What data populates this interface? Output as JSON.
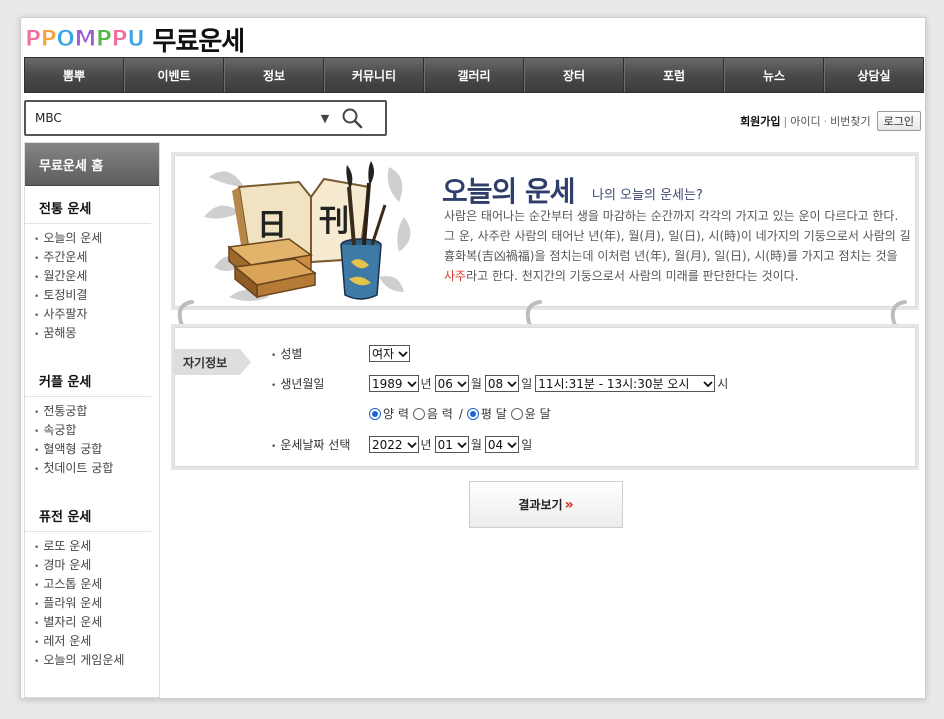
{
  "header": {
    "logo_letters": [
      "P",
      "P",
      "O",
      "M",
      "P",
      "P",
      "U"
    ],
    "logo_colors": [
      "#f36e9b",
      "#f9a23a",
      "#3aa4e8",
      "#9d5cd6",
      "#55b94a",
      "#f36e9b",
      "#3aa4e8"
    ],
    "site_title": "무료운세"
  },
  "nav": {
    "items": [
      "뽐뿌",
      "이벤트",
      "정보",
      "커뮤니티",
      "갤러리",
      "장터",
      "포럼",
      "뉴스",
      "상담실"
    ]
  },
  "search": {
    "value": "MBC",
    "dropdown_icon": "triangle-down-icon",
    "search_icon": "magnifier-icon"
  },
  "userlinks": {
    "join": "회원가입",
    "divider": "|",
    "find_id": "아이디",
    "dot": "·",
    "find_pw": "비번찾기",
    "login": "로그인"
  },
  "sidebar": {
    "home": "무료운세 홈",
    "sections": [
      {
        "title": "전통 운세",
        "items": [
          "오늘의 운세",
          "주간운세",
          "월간운세",
          "토정비결",
          "사주팔자",
          "꿈해몽"
        ]
      },
      {
        "title": "커플 운세",
        "items": [
          "전통궁합",
          "속궁합",
          "혈액형 궁합",
          "첫데이트 궁합"
        ]
      },
      {
        "title": "퓨전 운세",
        "items": [
          "로또 운세",
          "경마 운세",
          "고스톱 운세",
          "플라워 운세",
          "별자리 운세",
          "레저 운세",
          "오늘의 게임운세"
        ]
      }
    ]
  },
  "banner": {
    "title": "오늘의 운세",
    "subtitle": "나의 오늘의 운세는?",
    "text_before": "사람은 태어나는 순간부터 생을 마감하는 순간까지 각각의 가지고 있는 운이 다르다고 한다. 그 운, 사주란 사람의 태어난 년(年), 월(月), 일(日), 시(時)이 네가지의 기둥으로서 사람의 길흉화복(吉凶禍福)을 점치는데 이처럼 년(年), 월(月), 일(日), 시(時)를 가지고 점치는 것을 ",
    "highlight": "사주",
    "text_after": "라고 한다. 천지간의 기둥으로서 사람의 미래를 판단한다는 것이다.",
    "art_chars": "日 刊",
    "accent": "#2f3e6b"
  },
  "form": {
    "tag": "자기정보",
    "gender": {
      "label": "성별",
      "value": "여자"
    },
    "birth": {
      "label": "생년월일",
      "year": "1989",
      "year_unit": "년",
      "month": "06",
      "month_unit": "월",
      "day": "08",
      "day_unit": "일",
      "time": "11시:31분 - 13시:30분 오시",
      "time_unit": "시"
    },
    "calendar": {
      "solar": "양 력",
      "lunar": "음 력",
      "slash": "/",
      "normal": "평 달",
      "leap": "윤 달"
    },
    "fortune_date": {
      "label": "운세날짜 선택",
      "year": "2022",
      "year_unit": "년",
      "month": "01",
      "month_unit": "월",
      "day": "04",
      "day_unit": "일"
    },
    "submit": "결과보기",
    "submit_arrow": "»"
  }
}
